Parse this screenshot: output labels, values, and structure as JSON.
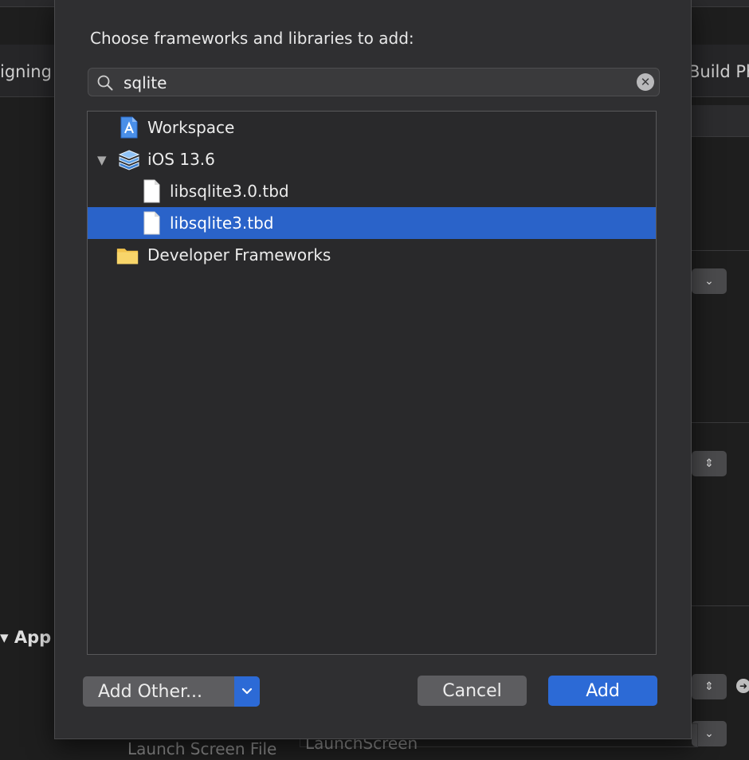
{
  "background": {
    "tab_left_partial": "igning",
    "tab_right_partial": "Build Ph",
    "section_title": "App",
    "launch_screen_label": "Launch Screen File",
    "launch_screen_value": "LaunchScreen"
  },
  "dialog": {
    "title": "Choose frameworks and libraries to add:",
    "search": {
      "value": "sqlite",
      "icon": "magnifying-glass-icon",
      "clear_icon": "clear-circle-icon"
    },
    "items": [
      {
        "label": "Workspace",
        "icon": "workspace-icon",
        "level": 0,
        "selected": false
      },
      {
        "label": "iOS 13.6",
        "icon": "sdk-stack-icon",
        "level": 0,
        "expanded": true,
        "selected": false
      },
      {
        "label": "libsqlite3.0.tbd",
        "icon": "document-icon",
        "level": 1,
        "selected": false
      },
      {
        "label": "libsqlite3.tbd",
        "icon": "document-icon",
        "level": 1,
        "selected": true
      },
      {
        "label": "Developer Frameworks",
        "icon": "folder-icon",
        "level": 0,
        "selected": false
      }
    ],
    "buttons": {
      "add_other": "Add Other...",
      "cancel": "Cancel",
      "add": "Add"
    }
  },
  "colors": {
    "accent": "#2c6ad6",
    "selection": "#2a63c9",
    "sheet": "#2f2f31"
  }
}
